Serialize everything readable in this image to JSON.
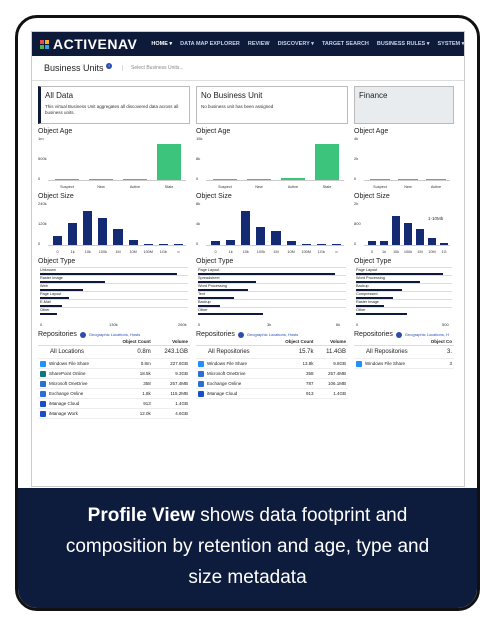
{
  "navbar": {
    "logo": "ACTIVENAV",
    "items": [
      "HOME ▾",
      "DATA MAP EXPLORER",
      "REVIEW",
      "DISCOVERY ▾",
      "TARGET SEARCH",
      "BUSINESS RULES ▾",
      "SYSTEM ▾"
    ]
  },
  "business_units": {
    "title": "Business Units",
    "select_placeholder": "Select Business Units..."
  },
  "columns": [
    {
      "title": "All Data",
      "desc": "This virtual Business Unit aggregates all discovered data across all business units.",
      "age": {
        "title": "Object Age",
        "yticks": [
          "1m",
          "500k",
          "0"
        ],
        "cats": [
          "Suspect",
          "New",
          "Active",
          "Stale"
        ],
        "values": [
          0.01,
          0.01,
          0.03,
          1.0
        ]
      },
      "size": {
        "title": "Object Size",
        "yticks": [
          "240k",
          "120k",
          "0"
        ],
        "cats": [
          "0",
          "1k",
          "10k",
          "100k",
          "1M",
          "10M",
          "100M",
          "1Gb",
          "∞"
        ],
        "values": [
          0.25,
          0.6,
          0.95,
          0.75,
          0.45,
          0.15,
          0.04,
          0.02,
          0.01
        ]
      },
      "type": {
        "title": "Object Type",
        "rows": [
          "Unknown",
          "Raster Image",
          "Web",
          "Page Layout",
          "E-Mail",
          "Other"
        ],
        "values": [
          0.95,
          0.45,
          0.3,
          0.2,
          0.15,
          0.12
        ],
        "xticks": [
          "0",
          "130k",
          "260k"
        ]
      },
      "repos": {
        "title": "Repositories",
        "links": "Geographic Locations, Hosts",
        "headers": [
          "",
          "Object Count",
          "Volume"
        ],
        "all_label": "All Locations",
        "all_count": "0.8m",
        "all_volume": "243.1GB",
        "rows": [
          {
            "name": "Windows File Share",
            "count": "0.8m",
            "volume": "227.8GB",
            "color": "#1e90ff"
          },
          {
            "name": "SharePoint Online",
            "count": "18.5k",
            "volume": "9.3GB",
            "color": "#0a7a7a"
          },
          {
            "name": "Microsoft OneDrive",
            "count": "358",
            "volume": "257.4MB",
            "color": "#2b6fd6"
          },
          {
            "name": "Exchange Online",
            "count": "1.8k",
            "volume": "115.2MB",
            "color": "#2b6fd6"
          },
          {
            "name": "iManage Cloud",
            "count": "913",
            "volume": "1.4GB",
            "color": "#1b4dc9"
          },
          {
            "name": "iManage Work",
            "count": "12.0k",
            "volume": "4.6GB",
            "color": "#1b4dc9"
          }
        ]
      }
    },
    {
      "title": "No Business Unit",
      "desc": "No business unit has been assigned",
      "age": {
        "title": "Object Age",
        "yticks": [
          "15k",
          "8k",
          "0"
        ],
        "cats": [
          "Suspect",
          "New",
          "Active",
          "Stale"
        ],
        "values": [
          0.01,
          0.02,
          0.06,
          1.0
        ]
      },
      "size": {
        "title": "Object Size",
        "yticks": [
          "8k",
          "4k",
          "0"
        ],
        "cats": [
          "0",
          "1k",
          "10k",
          "100k",
          "1M",
          "10M",
          "100M",
          "1Gb",
          "∞"
        ],
        "values": [
          0.12,
          0.15,
          0.95,
          0.5,
          0.38,
          0.12,
          0.03,
          0.01,
          0.01
        ]
      },
      "type": {
        "title": "Object Type",
        "rows": [
          "Page Layout",
          "Spreadsheet",
          "Word Processing",
          "Text",
          "Backup",
          "Other"
        ],
        "values": [
          0.95,
          0.4,
          0.35,
          0.25,
          0.15,
          0.45
        ],
        "xticks": [
          "0",
          "3k",
          "6k"
        ]
      },
      "repos": {
        "title": "Repositories",
        "links": "Geographic Locations, Hosts",
        "headers": [
          "",
          "Object Count",
          "Volume"
        ],
        "all_label": "All Repositories",
        "all_count": "15.7k",
        "all_volume": "11.4GB",
        "rows": [
          {
            "name": "Windows File Share",
            "count": "13.8k",
            "volume": "9.8GB",
            "color": "#1e90ff"
          },
          {
            "name": "Microsoft OneDrive",
            "count": "358",
            "volume": "257.4MB",
            "color": "#2b6fd6"
          },
          {
            "name": "Exchange Online",
            "count": "787",
            "volume": "106.1MB",
            "color": "#2b6fd6"
          },
          {
            "name": "iManage Cloud",
            "count": "913",
            "volume": "1.4GB",
            "color": "#1b4dc9"
          }
        ]
      }
    },
    {
      "title": "Finance",
      "desc": "",
      "age": {
        "title": "Object Age",
        "yticks": [
          "4k",
          "2k",
          "0"
        ],
        "cats": [
          "Suspect",
          "New",
          "Active"
        ],
        "values": [
          0.01,
          0.01,
          0.02
        ]
      },
      "size": {
        "title": "Object Size",
        "yticks": [
          "2k",
          "800",
          "0"
        ],
        "cats": [
          "0",
          "1k",
          "10k",
          "100k",
          "1M",
          "10M",
          "1G"
        ],
        "values": [
          0.1,
          0.12,
          0.8,
          0.6,
          0.45,
          0.2,
          0.05
        ],
        "annot": "1-10Mb"
      },
      "type": {
        "title": "Object Type",
        "rows": [
          "Page Layout",
          "Word Processing",
          "Backup",
          "Compressed",
          "Raster Image",
          "Other"
        ],
        "values": [
          0.95,
          0.7,
          0.5,
          0.4,
          0.3,
          0.55
        ],
        "xticks": [
          "0",
          "500"
        ]
      },
      "repos": {
        "title": "Repositories",
        "links": "Geographic Locations, H",
        "headers": [
          "",
          "Object Co"
        ],
        "all_label": "All Repositories",
        "all_count": "3.",
        "rows": [
          {
            "name": "Windows File Share",
            "count": "3",
            "color": "#1e90ff"
          }
        ]
      }
    }
  ],
  "caption": {
    "bold": "Profile View",
    "text": " shows data footprint and composition by retention and age, type and size metadata"
  }
}
